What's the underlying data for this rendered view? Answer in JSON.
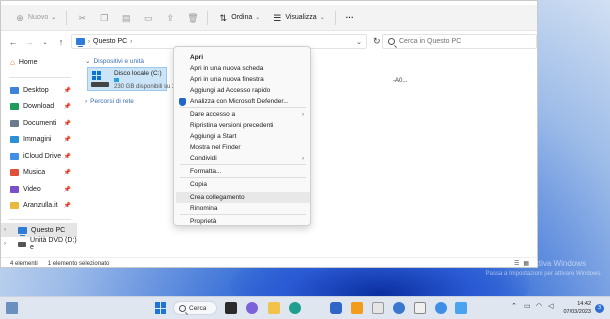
{
  "toolbar": {
    "new_label": "Nuovo",
    "sort_label": "Ordina",
    "view_label": "Visualizza",
    "more_label": "···"
  },
  "address": {
    "path": "Questo PC",
    "search_placeholder": "Cerca in Questo PC"
  },
  "sidebar": {
    "home_label": "Home",
    "quick_access": [
      {
        "label": "Desktop",
        "color": "#3b82d8"
      },
      {
        "label": "Download",
        "color": "#1f9a5a"
      },
      {
        "label": "Documenti",
        "color": "#6a7b8e"
      },
      {
        "label": "Immagini",
        "color": "#2b8fd6"
      },
      {
        "label": "iCloud Drive",
        "color": "#3f8fe8"
      },
      {
        "label": "Musica",
        "color": "#e0503a"
      },
      {
        "label": "Video",
        "color": "#7a4fc9"
      },
      {
        "label": "Aranzulla.it",
        "color": "#e8b93a"
      }
    ],
    "this_pc_label": "Questo PC",
    "dvd_label": "Unità DVD (D:) e"
  },
  "main": {
    "devices_header": "Dispositivi e unità",
    "drive_name": "Disco locale (C:)",
    "drive_free": "230 GB disponibili su 2",
    "drive_used_fraction": 0.1,
    "extra_text": "-A0...",
    "network_header": "Percorsi di rete"
  },
  "context_menu": {
    "items": [
      {
        "label": "Apri",
        "bold": true
      },
      {
        "label": "Apri in una nuova scheda"
      },
      {
        "label": "Apri in una nuova finestra"
      },
      {
        "label": "Aggiungi ad Accesso rapido"
      },
      {
        "label": "Analizza con Microsoft Defender..."
      },
      {
        "label": "Dare accesso a",
        "submenu": true
      },
      {
        "label": "Ripristina versioni precedenti"
      },
      {
        "label": "Aggiungi a Start"
      },
      {
        "label": "Mostra nel Finder"
      },
      {
        "label": "Condividi",
        "submenu": true
      },
      {
        "label": "Formatta..."
      },
      {
        "label": "Copia"
      },
      {
        "label": "Crea collegamento"
      },
      {
        "label": "Rinomina"
      },
      {
        "label": "Proprietà"
      }
    ]
  },
  "status": {
    "items_count": "4 elementi",
    "selected": "1 elemento selezionato"
  },
  "watermark": {
    "title": "Attiva Windows",
    "subtitle": "Passa a Impostazioni per attivare Windows."
  },
  "taskbar": {
    "search_label": "Cerca",
    "time": "14:42",
    "date": "07/03/2023",
    "notification_count": "3"
  }
}
